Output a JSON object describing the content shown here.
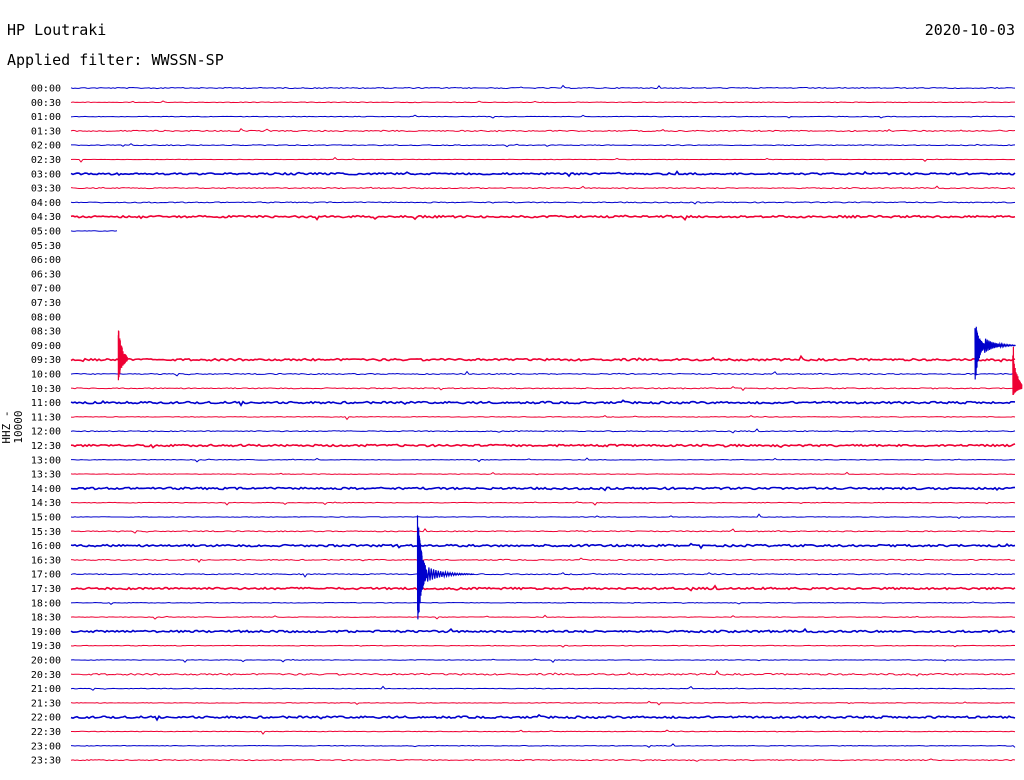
{
  "header": {
    "station": "HP Loutraki",
    "date": "2020-10-03",
    "filter": "Applied filter: WWSSN-SP"
  },
  "chart_data": {
    "type": "line",
    "title": "HP Loutraki",
    "subtitle": "Applied filter: WWSSN-SP",
    "ylabel": "HHZ - 10000",
    "xlabel": "",
    "colors": {
      "odd_row": "#0000cc",
      "even_row": "#ee0033"
    },
    "row_labels": [
      "00:00",
      "00:30",
      "01:00",
      "01:30",
      "02:00",
      "02:30",
      "03:00",
      "03:30",
      "04:00",
      "04:30",
      "05:00",
      "05:30",
      "06:00",
      "06:30",
      "07:00",
      "07:30",
      "08:00",
      "08:30",
      "09:00",
      "09:30",
      "10:00",
      "10:30",
      "11:00",
      "11:30",
      "12:00",
      "12:30",
      "13:00",
      "13:30",
      "14:00",
      "14:30",
      "15:00",
      "15:30",
      "16:00",
      "16:30",
      "17:00",
      "17:30",
      "18:00",
      "18:30",
      "19:00",
      "19:30",
      "20:00",
      "20:30",
      "21:00",
      "21:30",
      "22:00",
      "22:30",
      "23:00",
      "23:30"
    ],
    "row_noise": [
      0.5,
      0.3,
      0.3,
      0.6,
      0.4,
      0.2,
      0.9,
      0.5,
      0.5,
      1.0,
      0.3,
      0,
      0,
      0,
      0,
      0,
      0,
      0,
      0,
      1.0,
      0.5,
      0.5,
      1.0,
      0.3,
      0.5,
      1.0,
      0.3,
      0.3,
      1.0,
      0.3,
      0.3,
      0.5,
      1.0,
      0.5,
      0.5,
      1.0,
      0.3,
      0.3,
      1.0,
      0.3,
      0.3,
      0.8,
      0.3,
      0.3,
      1.0,
      0.3,
      0.3,
      0.5
    ],
    "row_extent": [
      1,
      1,
      1,
      1,
      1,
      1,
      1,
      1,
      1,
      1,
      0.05,
      0,
      0,
      0,
      0,
      0,
      0,
      0,
      0,
      1,
      1,
      1,
      1,
      1,
      1,
      1,
      1,
      1,
      1,
      1,
      1,
      1,
      1,
      1,
      1,
      1,
      1,
      1,
      1,
      1,
      1,
      1,
      1,
      1,
      1,
      1,
      1,
      1
    ],
    "gap_rows": {
      "start": "05:30",
      "end": "09:00"
    },
    "events": [
      {
        "row": "17:00",
        "minute": 11.0,
        "amplitude_up": 70,
        "amplitude_down": 60,
        "coda_minutes": 1.5,
        "label": ""
      },
      {
        "row": "09:30",
        "minute": 1.5,
        "amplitude_up": 36,
        "amplitude_down": 22,
        "coda_minutes": 0,
        "label": ""
      },
      {
        "row": "09:00",
        "minute": 28.7,
        "amplitude_up": 26,
        "amplitude_down": 42,
        "coda_minutes": 1.0,
        "label": ""
      },
      {
        "row": "10:30",
        "minute": 29.9,
        "amplitude_up": 50,
        "amplitude_down": 8,
        "coda_minutes": 0,
        "label": ""
      }
    ],
    "minutes_per_row": 30
  }
}
